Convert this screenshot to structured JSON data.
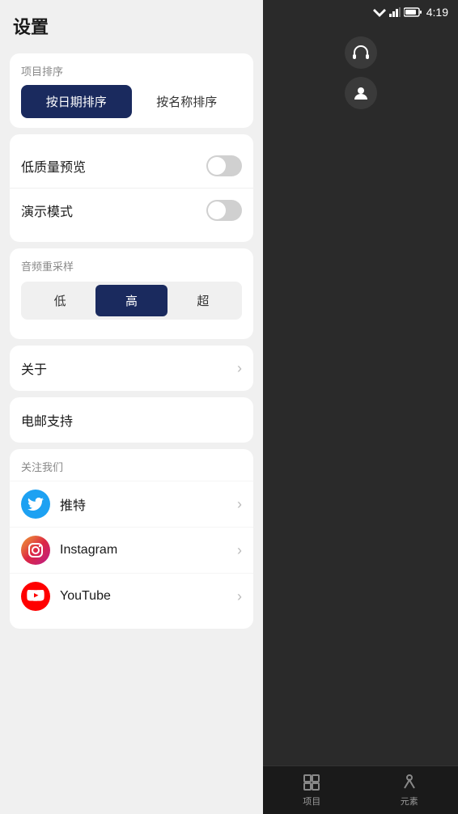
{
  "statusBar": {
    "time": "4:19"
  },
  "settings": {
    "pageTitle": "设置",
    "sortSection": {
      "label": "项目排序",
      "buttons": [
        {
          "id": "by-date",
          "label": "按日期排序",
          "active": true
        },
        {
          "id": "by-name",
          "label": "按名称排序",
          "active": false
        }
      ]
    },
    "toggleSection": {
      "items": [
        {
          "id": "low-quality",
          "label": "低质量预览",
          "on": false
        },
        {
          "id": "demo-mode",
          "label": "演示模式",
          "on": false
        }
      ]
    },
    "audioSection": {
      "label": "音频重采样",
      "options": [
        {
          "id": "low",
          "label": "低",
          "active": false
        },
        {
          "id": "high",
          "label": "高",
          "active": true
        },
        {
          "id": "ultra",
          "label": "超",
          "active": false
        }
      ]
    },
    "aboutRow": {
      "label": "关于"
    },
    "emailRow": {
      "label": "电邮支持"
    },
    "followSection": {
      "label": "关注我们",
      "items": [
        {
          "id": "twitter",
          "name": "推特",
          "iconType": "twitter"
        },
        {
          "id": "instagram",
          "name": "Instagram",
          "iconType": "instagram"
        },
        {
          "id": "youtube",
          "name": "YouTube",
          "iconType": "youtube"
        }
      ]
    }
  },
  "rightPanel": {
    "bottomNav": {
      "items": [
        {
          "id": "projects",
          "label": "项目"
        },
        {
          "id": "elements",
          "label": "元素"
        }
      ]
    }
  }
}
